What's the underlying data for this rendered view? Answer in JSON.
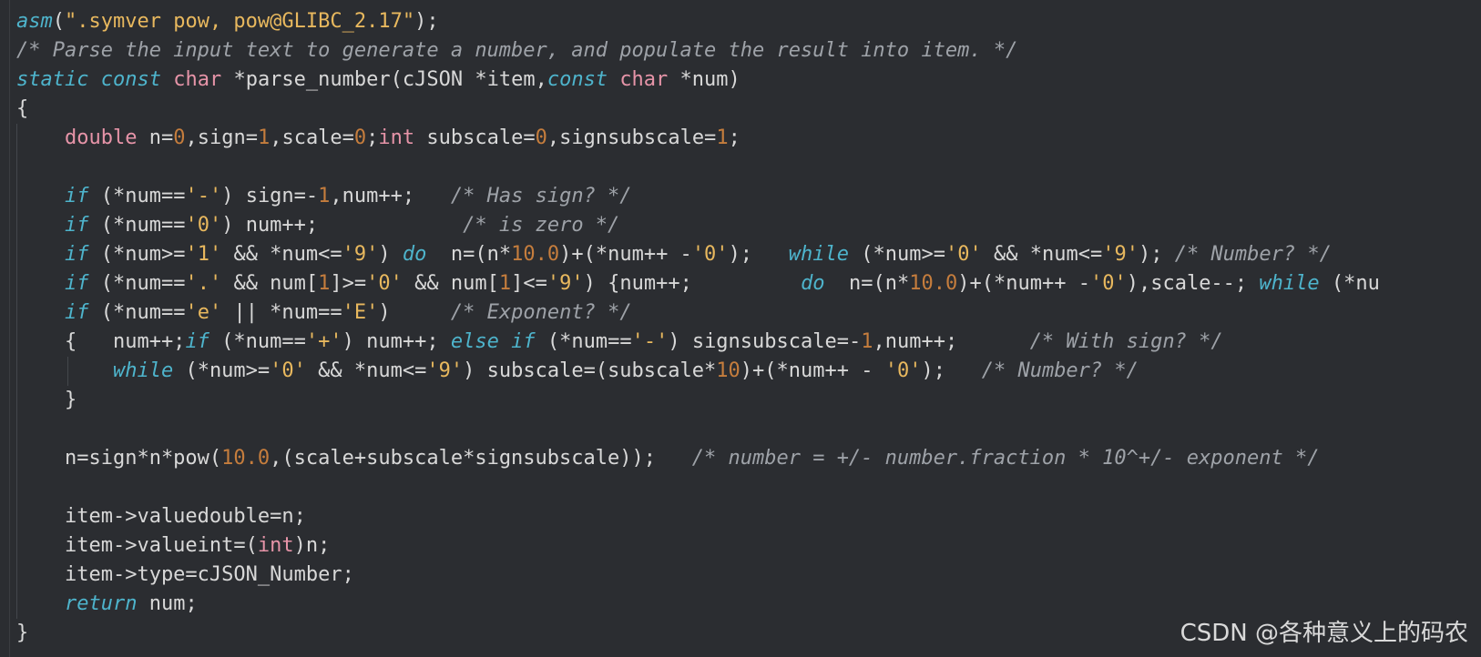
{
  "editor": {
    "language": "c",
    "colors": {
      "background": "#2b2d31",
      "keyword": "#4eb4cc",
      "type": "#e694a8",
      "string": "#e8b85e",
      "number": "#c57d3d",
      "comment": "#9ea2a8",
      "text": "#d8d8d8"
    },
    "lines": [
      [
        {
          "t": "kw",
          "v": "asm"
        },
        {
          "t": "plain",
          "v": "("
        },
        {
          "t": "str",
          "v": "\".symver pow, pow@GLIBC_2.17\""
        },
        {
          "t": "plain",
          "v": ");"
        }
      ],
      [
        {
          "t": "cmt",
          "v": "/* Parse the input text to generate a number, and populate the result into item. */"
        }
      ],
      [
        {
          "t": "kw",
          "v": "static"
        },
        {
          "t": "plain",
          "v": " "
        },
        {
          "t": "kw",
          "v": "const"
        },
        {
          "t": "plain",
          "v": " "
        },
        {
          "t": "type",
          "v": "char"
        },
        {
          "t": "plain",
          "v": " *parse_number(cJSON *item,"
        },
        {
          "t": "kw",
          "v": "const"
        },
        {
          "t": "plain",
          "v": " "
        },
        {
          "t": "type",
          "v": "char"
        },
        {
          "t": "plain",
          "v": " *num)"
        }
      ],
      [
        {
          "t": "plain",
          "v": "{"
        }
      ],
      [
        {
          "t": "plain",
          "v": "    "
        },
        {
          "t": "type",
          "v": "double"
        },
        {
          "t": "plain",
          "v": " n="
        },
        {
          "t": "num",
          "v": "0"
        },
        {
          "t": "plain",
          "v": ",sign="
        },
        {
          "t": "num",
          "v": "1"
        },
        {
          "t": "plain",
          "v": ",scale="
        },
        {
          "t": "num",
          "v": "0"
        },
        {
          "t": "plain",
          "v": ";"
        },
        {
          "t": "type",
          "v": "int"
        },
        {
          "t": "plain",
          "v": " subscale="
        },
        {
          "t": "num",
          "v": "0"
        },
        {
          "t": "plain",
          "v": ",signsubscale="
        },
        {
          "t": "num",
          "v": "1"
        },
        {
          "t": "plain",
          "v": ";"
        }
      ],
      [],
      [
        {
          "t": "plain",
          "v": "    "
        },
        {
          "t": "kw",
          "v": "if"
        },
        {
          "t": "plain",
          "v": " (*num=="
        },
        {
          "t": "str",
          "v": "'-'"
        },
        {
          "t": "plain",
          "v": ") sign=-"
        },
        {
          "t": "num",
          "v": "1"
        },
        {
          "t": "plain",
          "v": ",num++;   "
        },
        {
          "t": "cmt",
          "v": "/* Has sign? */"
        }
      ],
      [
        {
          "t": "plain",
          "v": "    "
        },
        {
          "t": "kw",
          "v": "if"
        },
        {
          "t": "plain",
          "v": " (*num=="
        },
        {
          "t": "str",
          "v": "'0'"
        },
        {
          "t": "plain",
          "v": ") num++;            "
        },
        {
          "t": "cmt",
          "v": "/* is zero */"
        }
      ],
      [
        {
          "t": "plain",
          "v": "    "
        },
        {
          "t": "kw",
          "v": "if"
        },
        {
          "t": "plain",
          "v": " (*num>="
        },
        {
          "t": "str",
          "v": "'1'"
        },
        {
          "t": "plain",
          "v": " && *num<="
        },
        {
          "t": "str",
          "v": "'9'"
        },
        {
          "t": "plain",
          "v": ") "
        },
        {
          "t": "kw",
          "v": "do"
        },
        {
          "t": "plain",
          "v": "  n=(n*"
        },
        {
          "t": "num",
          "v": "10.0"
        },
        {
          "t": "plain",
          "v": ")+(*num++ -"
        },
        {
          "t": "str",
          "v": "'0'"
        },
        {
          "t": "plain",
          "v": ");   "
        },
        {
          "t": "kw",
          "v": "while"
        },
        {
          "t": "plain",
          "v": " (*num>="
        },
        {
          "t": "str",
          "v": "'0'"
        },
        {
          "t": "plain",
          "v": " && *num<="
        },
        {
          "t": "str",
          "v": "'9'"
        },
        {
          "t": "plain",
          "v": "); "
        },
        {
          "t": "cmt",
          "v": "/* Number? */"
        }
      ],
      [
        {
          "t": "plain",
          "v": "    "
        },
        {
          "t": "kw",
          "v": "if"
        },
        {
          "t": "plain",
          "v": " (*num=="
        },
        {
          "t": "str",
          "v": "'.'"
        },
        {
          "t": "plain",
          "v": " && num["
        },
        {
          "t": "num",
          "v": "1"
        },
        {
          "t": "plain",
          "v": "]>="
        },
        {
          "t": "str",
          "v": "'0'"
        },
        {
          "t": "plain",
          "v": " && num["
        },
        {
          "t": "num",
          "v": "1"
        },
        {
          "t": "plain",
          "v": "]<="
        },
        {
          "t": "str",
          "v": "'9'"
        },
        {
          "t": "plain",
          "v": ") {num++;         "
        },
        {
          "t": "kw",
          "v": "do"
        },
        {
          "t": "plain",
          "v": "  n=(n*"
        },
        {
          "t": "num",
          "v": "10.0"
        },
        {
          "t": "plain",
          "v": ")+(*num++ -"
        },
        {
          "t": "str",
          "v": "'0'"
        },
        {
          "t": "plain",
          "v": "),scale--; "
        },
        {
          "t": "kw",
          "v": "while"
        },
        {
          "t": "plain",
          "v": " (*nu"
        }
      ],
      [
        {
          "t": "plain",
          "v": "    "
        },
        {
          "t": "kw",
          "v": "if"
        },
        {
          "t": "plain",
          "v": " (*num=="
        },
        {
          "t": "str",
          "v": "'e'"
        },
        {
          "t": "plain",
          "v": " || *num=="
        },
        {
          "t": "str",
          "v": "'E'"
        },
        {
          "t": "plain",
          "v": ")     "
        },
        {
          "t": "cmt",
          "v": "/* Exponent? */"
        }
      ],
      [
        {
          "t": "plain",
          "v": "    {   num++;"
        },
        {
          "t": "kw",
          "v": "if"
        },
        {
          "t": "plain",
          "v": " (*num=="
        },
        {
          "t": "str",
          "v": "'+'"
        },
        {
          "t": "plain",
          "v": ") num++; "
        },
        {
          "t": "kw",
          "v": "else"
        },
        {
          "t": "plain",
          "v": " "
        },
        {
          "t": "kw",
          "v": "if"
        },
        {
          "t": "plain",
          "v": " (*num=="
        },
        {
          "t": "str",
          "v": "'-'"
        },
        {
          "t": "plain",
          "v": ") signsubscale=-"
        },
        {
          "t": "num",
          "v": "1"
        },
        {
          "t": "plain",
          "v": ",num++;      "
        },
        {
          "t": "cmt",
          "v": "/* With sign? */"
        }
      ],
      [
        {
          "t": "plain",
          "v": "        "
        },
        {
          "t": "kw",
          "v": "while"
        },
        {
          "t": "plain",
          "v": " (*num>="
        },
        {
          "t": "str",
          "v": "'0'"
        },
        {
          "t": "plain",
          "v": " && *num<="
        },
        {
          "t": "str",
          "v": "'9'"
        },
        {
          "t": "plain",
          "v": ") subscale=(subscale*"
        },
        {
          "t": "num",
          "v": "10"
        },
        {
          "t": "plain",
          "v": ")+(*num++ - "
        },
        {
          "t": "str",
          "v": "'0'"
        },
        {
          "t": "plain",
          "v": ");   "
        },
        {
          "t": "cmt",
          "v": "/* Number? */"
        }
      ],
      [
        {
          "t": "plain",
          "v": "    }"
        }
      ],
      [],
      [
        {
          "t": "plain",
          "v": "    n=sign*n*pow("
        },
        {
          "t": "num",
          "v": "10.0"
        },
        {
          "t": "plain",
          "v": ",(scale+subscale*signsubscale));   "
        },
        {
          "t": "cmt",
          "v": "/* number = +/- number.fraction * 10^+/- exponent */"
        }
      ],
      [],
      [
        {
          "t": "plain",
          "v": "    item->valuedouble=n;"
        }
      ],
      [
        {
          "t": "plain",
          "v": "    item->valueint=("
        },
        {
          "t": "type",
          "v": "int"
        },
        {
          "t": "plain",
          "v": ")n;"
        }
      ],
      [
        {
          "t": "plain",
          "v": "    item->type=cJSON_Number;"
        }
      ],
      [
        {
          "t": "plain",
          "v": "    "
        },
        {
          "t": "kw",
          "v": "return"
        },
        {
          "t": "plain",
          "v": " num;"
        }
      ],
      [
        {
          "t": "plain",
          "v": "}"
        }
      ]
    ]
  },
  "watermark": {
    "text": "CSDN @各种意义上的码农"
  }
}
